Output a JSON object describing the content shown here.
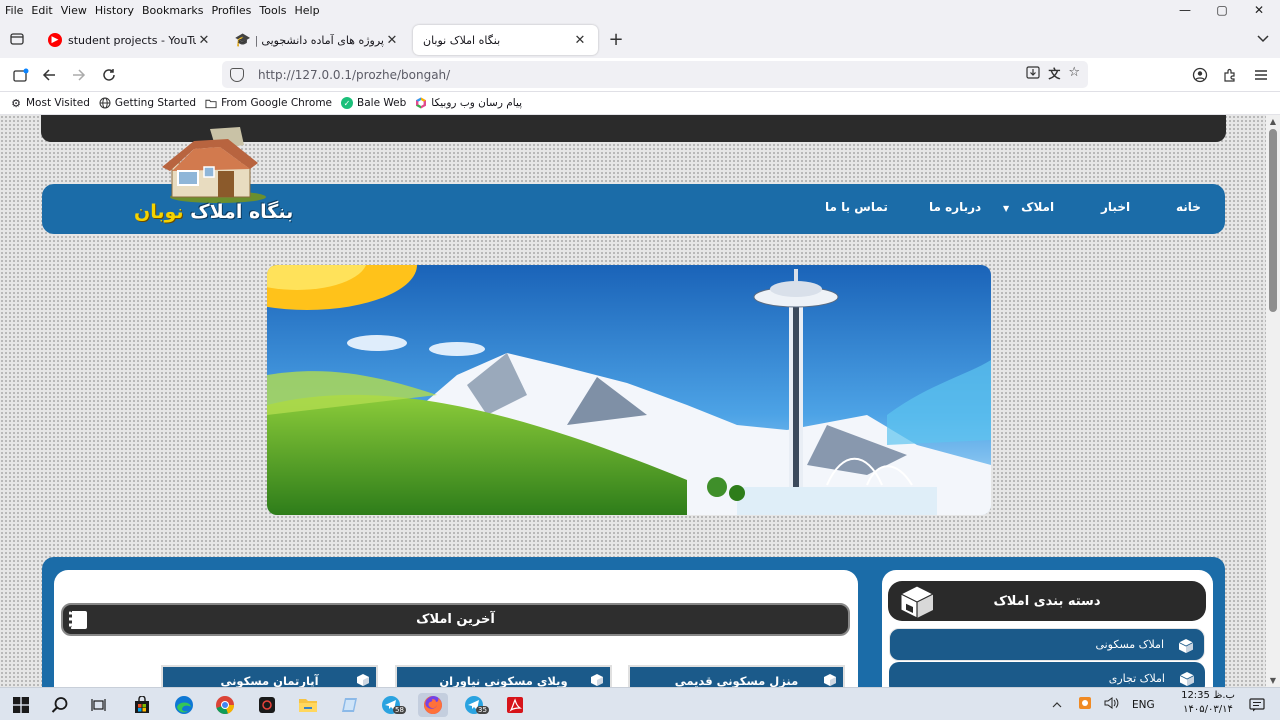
{
  "menu": [
    "File",
    "Edit",
    "View",
    "History",
    "Bookmarks",
    "Profiles",
    "Tools",
    "Help"
  ],
  "window_controls": {
    "minimize": "—",
    "maximize": "▢",
    "close": "✕"
  },
  "tabs": [
    {
      "title": "student projects - YouTube",
      "icon": "youtube-icon"
    },
    {
      "title": "پروژه های آماده دانشجویی | دانل",
      "icon": "graduation-cap-icon"
    },
    {
      "title": "بنگاه املاک نوبان",
      "icon": "blank-page-icon",
      "active": true
    }
  ],
  "new_tab": "+",
  "address": {
    "url": "http://127.0.0.1/prozhe/bongah/"
  },
  "bookmarks": [
    "Most Visited",
    "Getting Started",
    "From Google Chrome",
    "Bale Web",
    "پیام رسان وب روبیکا"
  ],
  "site": {
    "logo_part1": "بنگاه املاک",
    "logo_part2": "نوبان",
    "nav": [
      "خانه",
      "اخبار",
      "املاک",
      "درباره ما",
      "تماس با ما"
    ],
    "latest_title": "آخرین املاک",
    "cards": [
      "منزل مسکونی قدیمی",
      "ویلای مسکونی نیاوران",
      "آپارتمان مسکونی"
    ],
    "category_title": "دسته بندی املاک",
    "categories": [
      "املاک مسکونی",
      "املاک تجاری"
    ]
  },
  "colors": {
    "header_blue": "#1b6ca8",
    "dark": "#2b2b2b",
    "logo_yellow": "#f5d300"
  },
  "taskbar": {
    "icons": [
      "windows-start-icon",
      "search-icon",
      "task-view-icon",
      "store-icon",
      "edge-icon",
      "chrome-icon",
      "app-icon",
      "file-explorer-icon",
      "notes-icon",
      "telegram-icon",
      "firefox-icon",
      "telegram-icon",
      "acrobat-icon"
    ],
    "badges": [
      "58",
      "35"
    ],
    "lang": "ENG",
    "time": "12:35 ب.ظ",
    "date": "۱۴۰۵/۰۳/۱۴"
  }
}
